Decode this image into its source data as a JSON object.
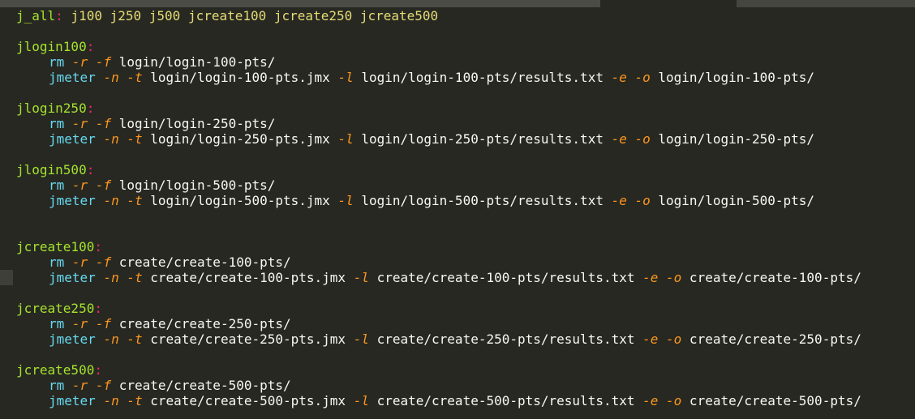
{
  "editor": {
    "lines": [
      {
        "type": "rule",
        "target": "j_all",
        "colon": ":",
        "deps": " j100 j250 j500 jcreate100 jcreate250 jcreate500"
      },
      {
        "type": "blank"
      },
      {
        "type": "rule",
        "target": "jlogin100",
        "colon": ":"
      },
      {
        "type": "cmd",
        "parts": [
          [
            "cmd",
            "rm"
          ],
          [
            "arg",
            " "
          ],
          [
            "flag",
            "-r"
          ],
          [
            "arg",
            " "
          ],
          [
            "flag",
            "-f"
          ],
          [
            "arg",
            " login/login-100-pts/"
          ]
        ]
      },
      {
        "type": "cmd",
        "parts": [
          [
            "cmd",
            "jmeter"
          ],
          [
            "arg",
            " "
          ],
          [
            "flag",
            "-n"
          ],
          [
            "arg",
            " "
          ],
          [
            "flag",
            "-t"
          ],
          [
            "arg",
            " login/login-100-pts.jmx "
          ],
          [
            "flag",
            "-l"
          ],
          [
            "arg",
            " login/login-100-pts/results.txt "
          ],
          [
            "flag",
            "-e"
          ],
          [
            "arg",
            " "
          ],
          [
            "flag",
            "-o"
          ],
          [
            "arg",
            " login/login-100-pts/"
          ]
        ]
      },
      {
        "type": "blank"
      },
      {
        "type": "rule",
        "target": "jlogin250",
        "colon": ":"
      },
      {
        "type": "cmd",
        "parts": [
          [
            "cmd",
            "rm"
          ],
          [
            "arg",
            " "
          ],
          [
            "flag",
            "-r"
          ],
          [
            "arg",
            " "
          ],
          [
            "flag",
            "-f"
          ],
          [
            "arg",
            " login/login-250-pts/"
          ]
        ]
      },
      {
        "type": "cmd",
        "parts": [
          [
            "cmd",
            "jmeter"
          ],
          [
            "arg",
            " "
          ],
          [
            "flag",
            "-n"
          ],
          [
            "arg",
            " "
          ],
          [
            "flag",
            "-t"
          ],
          [
            "arg",
            " login/login-250-pts.jmx "
          ],
          [
            "flag",
            "-l"
          ],
          [
            "arg",
            " login/login-250-pts/results.txt "
          ],
          [
            "flag",
            "-e"
          ],
          [
            "arg",
            " "
          ],
          [
            "flag",
            "-o"
          ],
          [
            "arg",
            " login/login-250-pts/"
          ]
        ]
      },
      {
        "type": "blank"
      },
      {
        "type": "rule",
        "target": "jlogin500",
        "colon": ":"
      },
      {
        "type": "cmd",
        "parts": [
          [
            "cmd",
            "rm"
          ],
          [
            "arg",
            " "
          ],
          [
            "flag",
            "-r"
          ],
          [
            "arg",
            " "
          ],
          [
            "flag",
            "-f"
          ],
          [
            "arg",
            " login/login-500-pts/"
          ]
        ]
      },
      {
        "type": "cmd",
        "parts": [
          [
            "cmd",
            "jmeter"
          ],
          [
            "arg",
            " "
          ],
          [
            "flag",
            "-n"
          ],
          [
            "arg",
            " "
          ],
          [
            "flag",
            "-t"
          ],
          [
            "arg",
            " login/login-500-pts.jmx "
          ],
          [
            "flag",
            "-l"
          ],
          [
            "arg",
            " login/login-500-pts/results.txt "
          ],
          [
            "flag",
            "-e"
          ],
          [
            "arg",
            " "
          ],
          [
            "flag",
            "-o"
          ],
          [
            "arg",
            " login/login-500-pts/"
          ]
        ]
      },
      {
        "type": "blank"
      },
      {
        "type": "blank"
      },
      {
        "type": "rule",
        "target": "jcreate100",
        "colon": ":"
      },
      {
        "type": "cmd",
        "parts": [
          [
            "cmd",
            "rm"
          ],
          [
            "arg",
            " "
          ],
          [
            "flag",
            "-r"
          ],
          [
            "arg",
            " "
          ],
          [
            "flag",
            "-f"
          ],
          [
            "arg",
            " create/create-100-pts/"
          ]
        ]
      },
      {
        "type": "cmd",
        "parts": [
          [
            "cmd",
            "jmeter"
          ],
          [
            "arg",
            " "
          ],
          [
            "flag",
            "-n"
          ],
          [
            "arg",
            " "
          ],
          [
            "flag",
            "-t"
          ],
          [
            "arg",
            " create/create-100-pts.jmx "
          ],
          [
            "flag",
            "-l"
          ],
          [
            "arg",
            " create/create-100-pts/results.txt "
          ],
          [
            "flag",
            "-e"
          ],
          [
            "arg",
            " "
          ],
          [
            "flag",
            "-o"
          ],
          [
            "arg",
            " create/create-100-pts/"
          ]
        ]
      },
      {
        "type": "blank"
      },
      {
        "type": "rule",
        "target": "jcreate250",
        "colon": ":"
      },
      {
        "type": "cmd",
        "parts": [
          [
            "cmd",
            "rm"
          ],
          [
            "arg",
            " "
          ],
          [
            "flag",
            "-r"
          ],
          [
            "arg",
            " "
          ],
          [
            "flag",
            "-f"
          ],
          [
            "arg",
            " create/create-250-pts/"
          ]
        ]
      },
      {
        "type": "cmd",
        "parts": [
          [
            "cmd",
            "jmeter"
          ],
          [
            "arg",
            " "
          ],
          [
            "flag",
            "-n"
          ],
          [
            "arg",
            " "
          ],
          [
            "flag",
            "-t"
          ],
          [
            "arg",
            " create/create-250-pts.jmx "
          ],
          [
            "flag",
            "-l"
          ],
          [
            "arg",
            " create/create-250-pts/results.txt "
          ],
          [
            "flag",
            "-e"
          ],
          [
            "arg",
            " "
          ],
          [
            "flag",
            "-o"
          ],
          [
            "arg",
            " create/create-250-pts/"
          ]
        ]
      },
      {
        "type": "blank"
      },
      {
        "type": "rule",
        "target": "jcreate500",
        "colon": ":"
      },
      {
        "type": "cmd",
        "parts": [
          [
            "cmd",
            "rm"
          ],
          [
            "arg",
            " "
          ],
          [
            "flag",
            "-r"
          ],
          [
            "arg",
            " "
          ],
          [
            "flag",
            "-f"
          ],
          [
            "arg",
            " create/create-500-pts/"
          ]
        ]
      },
      {
        "type": "cmd",
        "parts": [
          [
            "cmd",
            "jmeter"
          ],
          [
            "arg",
            " "
          ],
          [
            "flag",
            "-n"
          ],
          [
            "arg",
            " "
          ],
          [
            "flag",
            "-t"
          ],
          [
            "arg",
            " create/create-500-pts.jmx "
          ],
          [
            "flag",
            "-l"
          ],
          [
            "arg",
            " create/create-500-pts/results.txt "
          ],
          [
            "flag",
            "-e"
          ],
          [
            "arg",
            " "
          ],
          [
            "flag",
            "-o"
          ],
          [
            "arg",
            " create/create-500-pts/"
          ]
        ]
      }
    ]
  },
  "colors": {
    "background": "#272822",
    "target": "#a6e22e",
    "colon": "#f92672",
    "command": "#66d9ef",
    "flag": "#fd971f",
    "text": "#f8f8f2",
    "dependencies": "#e6db74"
  }
}
